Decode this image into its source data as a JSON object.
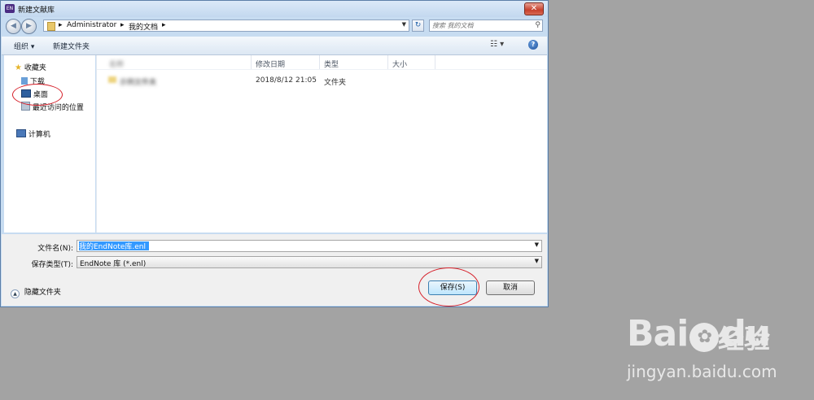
{
  "window": {
    "title": "新建文献库",
    "app_icon_text": "EN",
    "close_glyph": "✕"
  },
  "navigation": {
    "back_glyph": "◀",
    "forward_glyph": "▶",
    "breadcrumbs": [
      "Administrator",
      "我的文档"
    ],
    "crumb_sep": "▸",
    "refresh_glyph": "↻",
    "search_placeholder": "搜索 我的文档"
  },
  "toolbar": {
    "organize_label": "组织 ▾",
    "new_folder_label": "新建文件夹",
    "view_glyph": "☷ ▾",
    "help_glyph": "?"
  },
  "sidebar": {
    "favorites_label": "收藏夹",
    "items": [
      {
        "label": "下载",
        "icon": "download-icon"
      },
      {
        "label": "桌面",
        "icon": "desktop-icon"
      },
      {
        "label": "最近访问的位置",
        "icon": "recent-places-icon"
      }
    ],
    "computer_label": "计算机"
  },
  "file_list": {
    "columns": [
      "名称",
      "修改日期",
      "类型",
      "大小"
    ],
    "rows": [
      {
        "name": "示例文件夹",
        "modified": "2018/8/12 21:05",
        "type": "文件夹",
        "size": ""
      }
    ]
  },
  "form": {
    "filename_label": "文件名(N):",
    "filename_value": "我的EndNote库.enl",
    "filetype_label": "保存类型(T):",
    "filetype_value": "EndNote 库 (*.enl)",
    "hide_folders_label": "隐藏文件夹",
    "save_label": "保存(S)",
    "cancel_label": "取消"
  },
  "watermark": {
    "brand": [
      "Bai",
      "du"
    ],
    "paw_glyph": "✿",
    "brand_cn": "经验",
    "url": "jingyan.baidu.com"
  },
  "colors": {
    "annotation_red": "#d6202a",
    "selection_blue": "#3399ff"
  }
}
